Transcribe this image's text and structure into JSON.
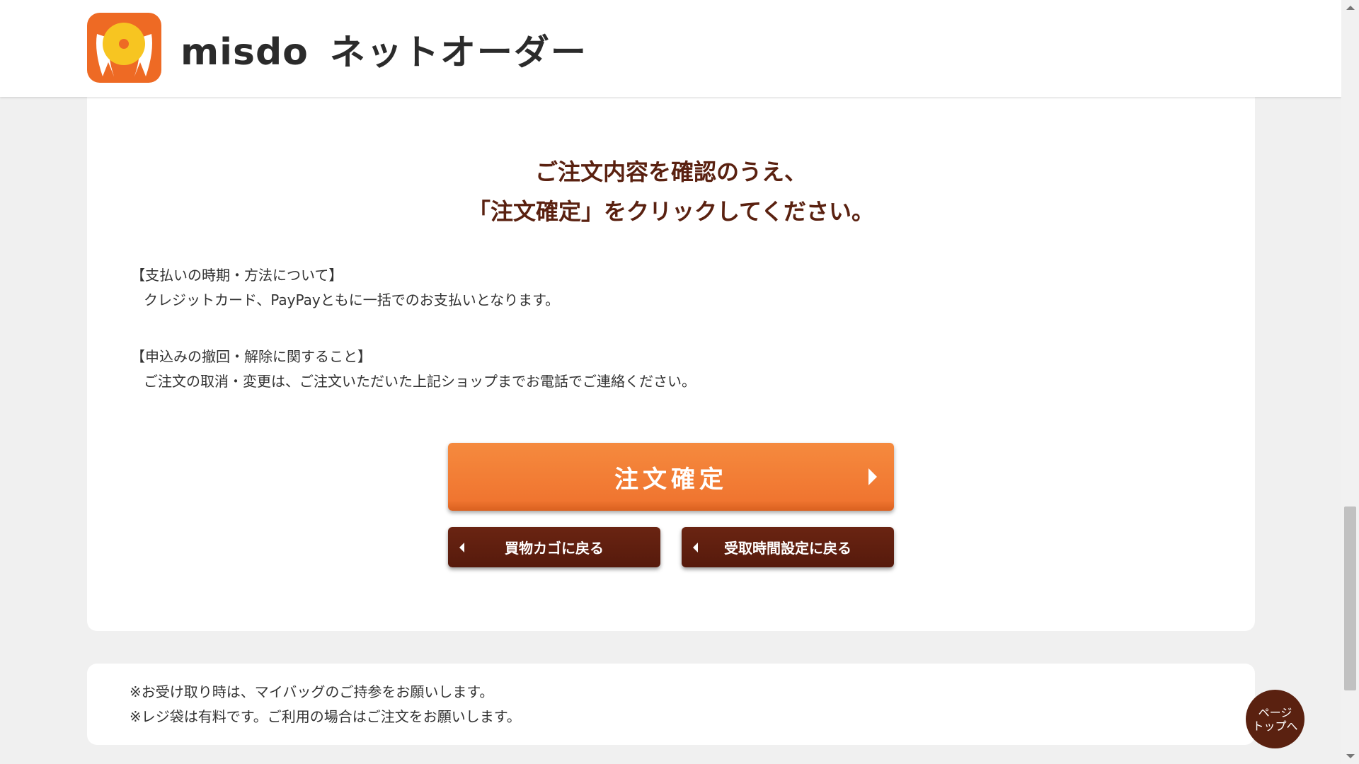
{
  "header": {
    "brand": "misdo",
    "service": "ネットオーダー",
    "logo_colors": {
      "orange": "#ee6a24",
      "yellow": "#f7c521",
      "white": "#ffffff"
    }
  },
  "main": {
    "heading_line1": "ご注文内容を確認のうえ、",
    "heading_line2": "「注文確定」をクリックしてください。",
    "payment": {
      "title": "【支払いの時期・方法について】",
      "body": "クレジットカード、PayPayともに一括でのお支払いとなります。"
    },
    "cancel": {
      "title": "【申込みの撤回・解除に関すること】",
      "body": "ご注文の取消・変更は、ご注文いただいた上記ショップまでお電話でご連絡ください。"
    },
    "confirm_button": "注文確定",
    "back_to_cart_button": "買物カゴに戻る",
    "back_to_time_button": "受取時間設定に戻る"
  },
  "notice": {
    "line1": "※お受け取り時は、マイバッグのご持参をお願いします。",
    "line2": "※レジ袋は有料です。ご利用の場合はご注文をお願いします。"
  },
  "page_top": {
    "line1": "ページ",
    "line2": "トップへ"
  },
  "colors": {
    "accent_orange": "#f07530",
    "brand_brown": "#5a2110",
    "background": "#f0f0f0"
  }
}
